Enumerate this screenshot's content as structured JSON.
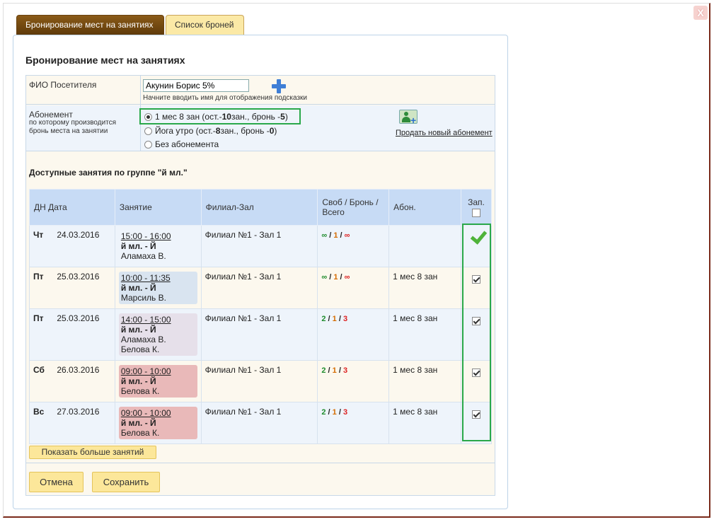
{
  "window": {
    "close_label": "X"
  },
  "tabs": [
    {
      "label": "Бронирование мест на занятиях",
      "active": true
    },
    {
      "label": "Список броней",
      "active": false
    }
  ],
  "panel": {
    "title": "Бронирование мест на занятиях"
  },
  "visitor": {
    "label": "ФИО Посетителя",
    "value": "Акунин Борис 5%",
    "hint": "Начните вводить имя для отображения подсказки"
  },
  "subscription": {
    "label": "Абонемент",
    "sublabel": "по которому производится бронь места на занятии",
    "options": [
      {
        "prefix": "1 мес 8 зан (ост.- ",
        "rest": "10",
        "mid": " зан., бронь - ",
        "bron": "5",
        "suffix": ")",
        "checked": true
      },
      {
        "prefix": "Йога утро (ост.- ",
        "rest": "8",
        "mid": " зан., бронь - ",
        "bron": "0",
        "suffix": ")",
        "checked": false
      },
      {
        "label": "Без абонемента",
        "checked": false
      }
    ],
    "sell_link": "Продать новый абонемент"
  },
  "lessons_section": {
    "title": "Доступные занятия по группе \"й мл.\""
  },
  "table": {
    "headers": {
      "date": "ДН Дата",
      "lesson": "Занятие",
      "branch": "Филиал-Зал",
      "counts": "Своб / Бронь / Всего",
      "abon": "Абон.",
      "zap": "Зап."
    },
    "rows": [
      {
        "day": "Чт",
        "date": "24.03.2016",
        "time": "15:00 - 16:00",
        "group": "й мл. - Й",
        "teachers": [
          "Аламаха В."
        ],
        "branch": "Филиал №1 - Зал 1",
        "free": "∞",
        "bron": "1",
        "total": "∞",
        "abon": "",
        "booked": true
      },
      {
        "day": "Пт",
        "date": "25.03.2016",
        "time": "10:00 - 11:35",
        "group": "й мл. - Й",
        "teachers": [
          "Марсиль В."
        ],
        "branch": "Филиал №1 - Зал 1",
        "free": "∞",
        "bron": "1",
        "total": "∞",
        "abon": "1 мес 8 зан",
        "booked": false
      },
      {
        "day": "Пт",
        "date": "25.03.2016",
        "time": "14:00 - 15:00",
        "group": "й мл. - Й",
        "teachers": [
          "Аламаха В.",
          "Белова К."
        ],
        "branch": "Филиал №1 - Зал 1",
        "free": "2",
        "bron": "1",
        "total": "3",
        "abon": "1 мес 8 зан",
        "booked": false
      },
      {
        "day": "Сб",
        "date": "26.03.2016",
        "time": "09:00 - 10:00",
        "group": "й мл. - Й",
        "teachers": [
          "Белова К."
        ],
        "branch": "Филиал №1 - Зал 1",
        "free": "2",
        "bron": "1",
        "total": "3",
        "abon": "1 мес 8 зан",
        "booked": false
      },
      {
        "day": "Вс",
        "date": "27.03.2016",
        "time": "09:00 - 10:00",
        "group": "й мл. - Й",
        "teachers": [
          "Белова К."
        ],
        "branch": "Филиал №1 - Зал 1",
        "free": "2",
        "bron": "1",
        "total": "3",
        "abon": "1 мес 8 зан",
        "booked": false
      }
    ]
  },
  "buttons": {
    "show_more": "Показать больше занятий",
    "cancel": "Отмена",
    "save": "Сохранить"
  }
}
